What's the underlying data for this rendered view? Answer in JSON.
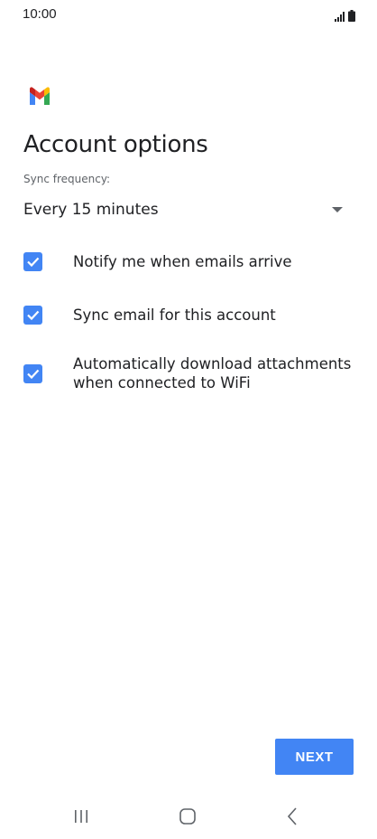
{
  "status_bar": {
    "time": "10:00",
    "icons": [
      "signal-icon",
      "battery-icon"
    ]
  },
  "app": {
    "logo": "gmail-logo-icon",
    "brand_colors": {
      "blue": "#4285f4",
      "red": "#ea4335",
      "yellow": "#fbbc04",
      "green": "#34a853"
    }
  },
  "page": {
    "title": "Account options"
  },
  "sync": {
    "label": "Sync frequency:",
    "selected": "Every 15 minutes"
  },
  "options": [
    {
      "label": "Notify me when emails arrive",
      "checked": true
    },
    {
      "label": "Sync email for this account",
      "checked": true
    },
    {
      "label": "Automatically download attachments when connected to WiFi",
      "checked": true
    }
  ],
  "actions": {
    "next_label": "NEXT"
  },
  "nav_bar": {
    "buttons": [
      "recents-icon",
      "home-icon",
      "back-icon"
    ]
  },
  "colors": {
    "accent": "#4285f4",
    "text": "#202124",
    "secondary_text": "#5f6368"
  }
}
